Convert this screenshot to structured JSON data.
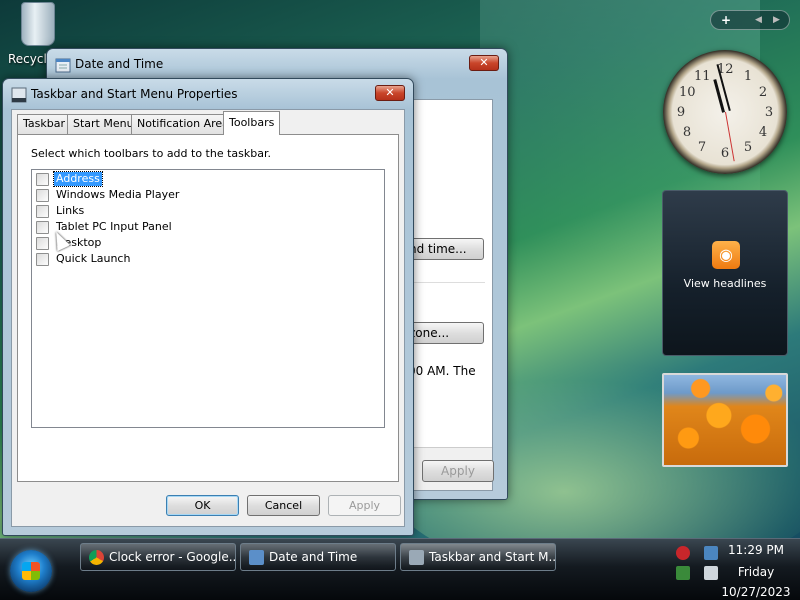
{
  "desktop": {
    "recycle_bin_label": "Recycle"
  },
  "bg_window": {
    "title": "Date and Time",
    "close": "✕",
    "btn_change_datetime": "nd time...",
    "btn_change_timezone": "zone...",
    "partial_text": "00 AM. The",
    "apply": "Apply"
  },
  "dialog": {
    "title": "Taskbar and Start Menu Properties",
    "close": "✕",
    "tabs": [
      "Taskbar",
      "Start Menu",
      "Notification Area",
      "Toolbars"
    ],
    "active_tab": "Toolbars",
    "instruction": "Select which toolbars to add to the taskbar.",
    "toolbars": [
      {
        "label": "Address",
        "checked": false,
        "selected": true
      },
      {
        "label": "Windows Media Player",
        "checked": false,
        "selected": false
      },
      {
        "label": "Links",
        "checked": false,
        "selected": false
      },
      {
        "label": "Tablet PC Input Panel",
        "checked": false,
        "selected": false
      },
      {
        "label": "Desktop",
        "checked": false,
        "selected": false
      },
      {
        "label": "Quick Launch",
        "checked": false,
        "selected": false
      }
    ],
    "ok": "OK",
    "cancel": "Cancel",
    "apply": "Apply"
  },
  "sidebar": {
    "add_gadget": "+",
    "prev": "◀",
    "next": "▶",
    "clock_numbers": [
      "12",
      "1",
      "2",
      "3",
      "4",
      "5",
      "6",
      "7",
      "8",
      "9",
      "10",
      "11"
    ],
    "feeds_label": "View headlines"
  },
  "taskbar": {
    "items": [
      {
        "label": "Clock error - Google...",
        "icon_color": "#dd4b39"
      },
      {
        "label": "Date and Time",
        "icon_color": "#5b8fc9"
      },
      {
        "label": "Taskbar and Start M...",
        "icon_color": "#9aa9b6"
      }
    ],
    "time": "11:29 PM",
    "day": "Friday",
    "date": "10/27/2023"
  }
}
